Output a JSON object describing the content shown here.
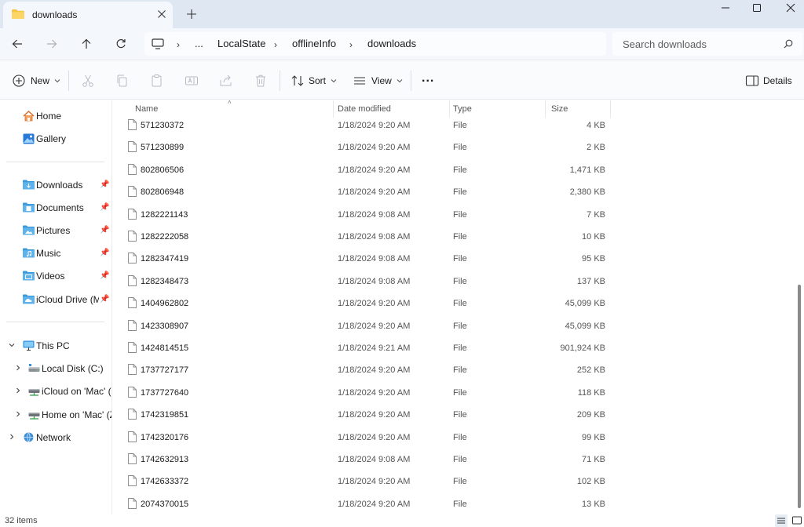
{
  "window": {
    "tab_title": "downloads",
    "tab_icon": "folder-icon",
    "new_tab_icon": "plus-icon"
  },
  "nav": {
    "back_icon": "arrow-left-icon",
    "forward_icon": "arrow-right-icon",
    "up_icon": "arrow-up-icon",
    "refresh_icon": "refresh-icon",
    "breadcrumb": [
      "...",
      "LocalState",
      "offlineInfo",
      "downloads"
    ],
    "search_placeholder": "Search downloads"
  },
  "toolbar": {
    "new_label": "New",
    "sort_label": "Sort",
    "view_label": "View",
    "more_label": "...",
    "details_label": "Details"
  },
  "sidebar": {
    "quick": [
      {
        "label": "Home",
        "icon": "home-icon"
      },
      {
        "label": "Gallery",
        "icon": "gallery-icon"
      }
    ],
    "pinned": [
      {
        "label": "Downloads",
        "icon": "downloads-folder-icon"
      },
      {
        "label": "Documents",
        "icon": "documents-folder-icon"
      },
      {
        "label": "Pictures",
        "icon": "pictures-folder-icon"
      },
      {
        "label": "Music",
        "icon": "music-folder-icon"
      },
      {
        "label": "Videos",
        "icon": "videos-folder-icon"
      },
      {
        "label": "iCloud Drive (Ma",
        "icon": "icloud-folder-icon"
      }
    ],
    "this_pc": {
      "label": "This PC",
      "icon": "computer-icon"
    },
    "drives": [
      {
        "label": "Local Disk (C:)",
        "icon": "disk-icon"
      },
      {
        "label": "iCloud on 'Mac' (U",
        "icon": "network-drive-icon"
      },
      {
        "label": "Home on 'Mac' (Z",
        "icon": "network-drive-icon"
      }
    ],
    "network": {
      "label": "Network",
      "icon": "network-icon"
    }
  },
  "columns": {
    "name": "Name",
    "date": "Date modified",
    "type": "Type",
    "size": "Size"
  },
  "files": [
    {
      "name": "571230372",
      "date": "1/18/2024 9:20 AM",
      "type": "File",
      "size": "4 KB"
    },
    {
      "name": "571230899",
      "date": "1/18/2024 9:20 AM",
      "type": "File",
      "size": "2 KB"
    },
    {
      "name": "802806506",
      "date": "1/18/2024 9:20 AM",
      "type": "File",
      "size": "1,471 KB"
    },
    {
      "name": "802806948",
      "date": "1/18/2024 9:20 AM",
      "type": "File",
      "size": "2,380 KB"
    },
    {
      "name": "1282221143",
      "date": "1/18/2024 9:08 AM",
      "type": "File",
      "size": "7 KB"
    },
    {
      "name": "1282222058",
      "date": "1/18/2024 9:08 AM",
      "type": "File",
      "size": "10 KB"
    },
    {
      "name": "1282347419",
      "date": "1/18/2024 9:08 AM",
      "type": "File",
      "size": "95 KB"
    },
    {
      "name": "1282348473",
      "date": "1/18/2024 9:08 AM",
      "type": "File",
      "size": "137 KB"
    },
    {
      "name": "1404962802",
      "date": "1/18/2024 9:20 AM",
      "type": "File",
      "size": "45,099 KB"
    },
    {
      "name": "1423308907",
      "date": "1/18/2024 9:20 AM",
      "type": "File",
      "size": "45,099 KB"
    },
    {
      "name": "1424814515",
      "date": "1/18/2024 9:21 AM",
      "type": "File",
      "size": "901,924 KB"
    },
    {
      "name": "1737727177",
      "date": "1/18/2024 9:20 AM",
      "type": "File",
      "size": "252 KB"
    },
    {
      "name": "1737727640",
      "date": "1/18/2024 9:20 AM",
      "type": "File",
      "size": "118 KB"
    },
    {
      "name": "1742319851",
      "date": "1/18/2024 9:20 AM",
      "type": "File",
      "size": "209 KB"
    },
    {
      "name": "1742320176",
      "date": "1/18/2024 9:20 AM",
      "type": "File",
      "size": "99 KB"
    },
    {
      "name": "1742632913",
      "date": "1/18/2024 9:08 AM",
      "type": "File",
      "size": "71 KB"
    },
    {
      "name": "1742633372",
      "date": "1/18/2024 9:20 AM",
      "type": "File",
      "size": "102 KB"
    },
    {
      "name": "2074370015",
      "date": "1/18/2024 9:20 AM",
      "type": "File",
      "size": "13 KB"
    }
  ],
  "status": {
    "item_count": "32 items"
  },
  "colors": {
    "folder": "#f6c443",
    "accent": "#1a73c7",
    "tabstrip": "#dfe7f2"
  }
}
